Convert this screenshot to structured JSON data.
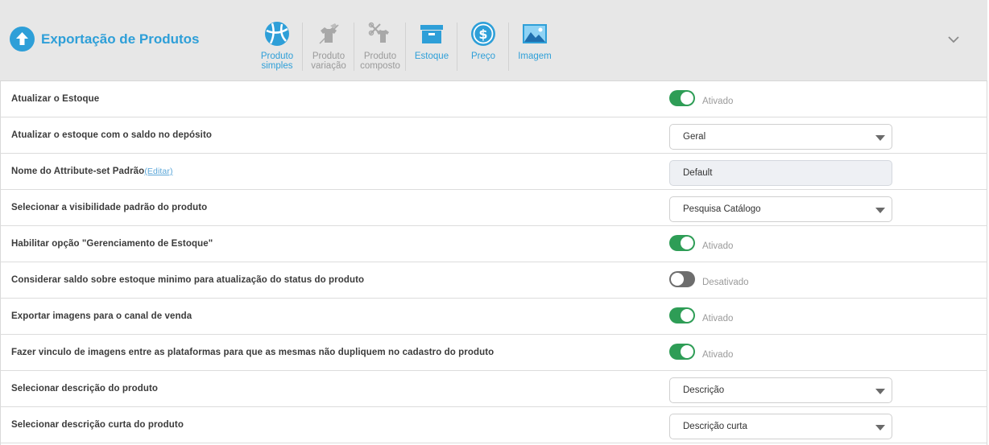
{
  "header": {
    "title": "Exportação de Produtos",
    "tabs": [
      {
        "line1": "Produto",
        "line2": "simples",
        "icon": "ball-icon",
        "active": true
      },
      {
        "line1": "Produto",
        "line2": "variação",
        "icon": "shirt-variation-icon",
        "active": false
      },
      {
        "line1": "Produto",
        "line2": "composto",
        "icon": "shirt-composite-icon",
        "active": false
      },
      {
        "line1": "Estoque",
        "line2": "",
        "icon": "box-icon",
        "active": true
      },
      {
        "line1": "Preço",
        "line2": "",
        "icon": "dollar-icon",
        "active": true
      },
      {
        "line1": "Imagem",
        "line2": "",
        "icon": "image-icon",
        "active": true
      }
    ]
  },
  "rows": [
    {
      "label": "Atualizar o Estoque",
      "control": "toggle",
      "state": "Ativado",
      "on": true
    },
    {
      "label": "Atualizar o estoque com o saldo no depósito",
      "control": "select",
      "value": "Geral"
    },
    {
      "label": "Nome do Attribute-set Padrão",
      "link": "(Editar)",
      "control": "readonly",
      "value": "Default"
    },
    {
      "label": "Selecionar a visibilidade padrão do produto",
      "control": "select",
      "value": "Pesquisa Catálogo"
    },
    {
      "label": "Habilitar opção \"Gerenciamento de Estoque\"",
      "control": "toggle",
      "state": "Ativado",
      "on": true
    },
    {
      "label": "Considerar saldo sobre estoque minimo para atualização do status do produto",
      "control": "toggle",
      "state": "Desativado",
      "on": false
    },
    {
      "label": "Exportar imagens para o canal de venda",
      "control": "toggle",
      "state": "Ativado",
      "on": true
    },
    {
      "label": "Fazer vinculo de imagens entre as plataformas para que as mesmas não dupliquem no cadastro do produto",
      "control": "toggle",
      "state": "Ativado",
      "on": true
    },
    {
      "label": "Selecionar descrição do produto",
      "control": "select",
      "value": "Descrição"
    },
    {
      "label": "Selecionar descrição curta do produto",
      "control": "select",
      "value": "Descrição curta"
    }
  ],
  "colors": {
    "accent": "#2e9fd8",
    "toggle_on": "#2e9d56",
    "toggle_off": "#6d6d6d",
    "header_bg": "#e7e7e7"
  }
}
